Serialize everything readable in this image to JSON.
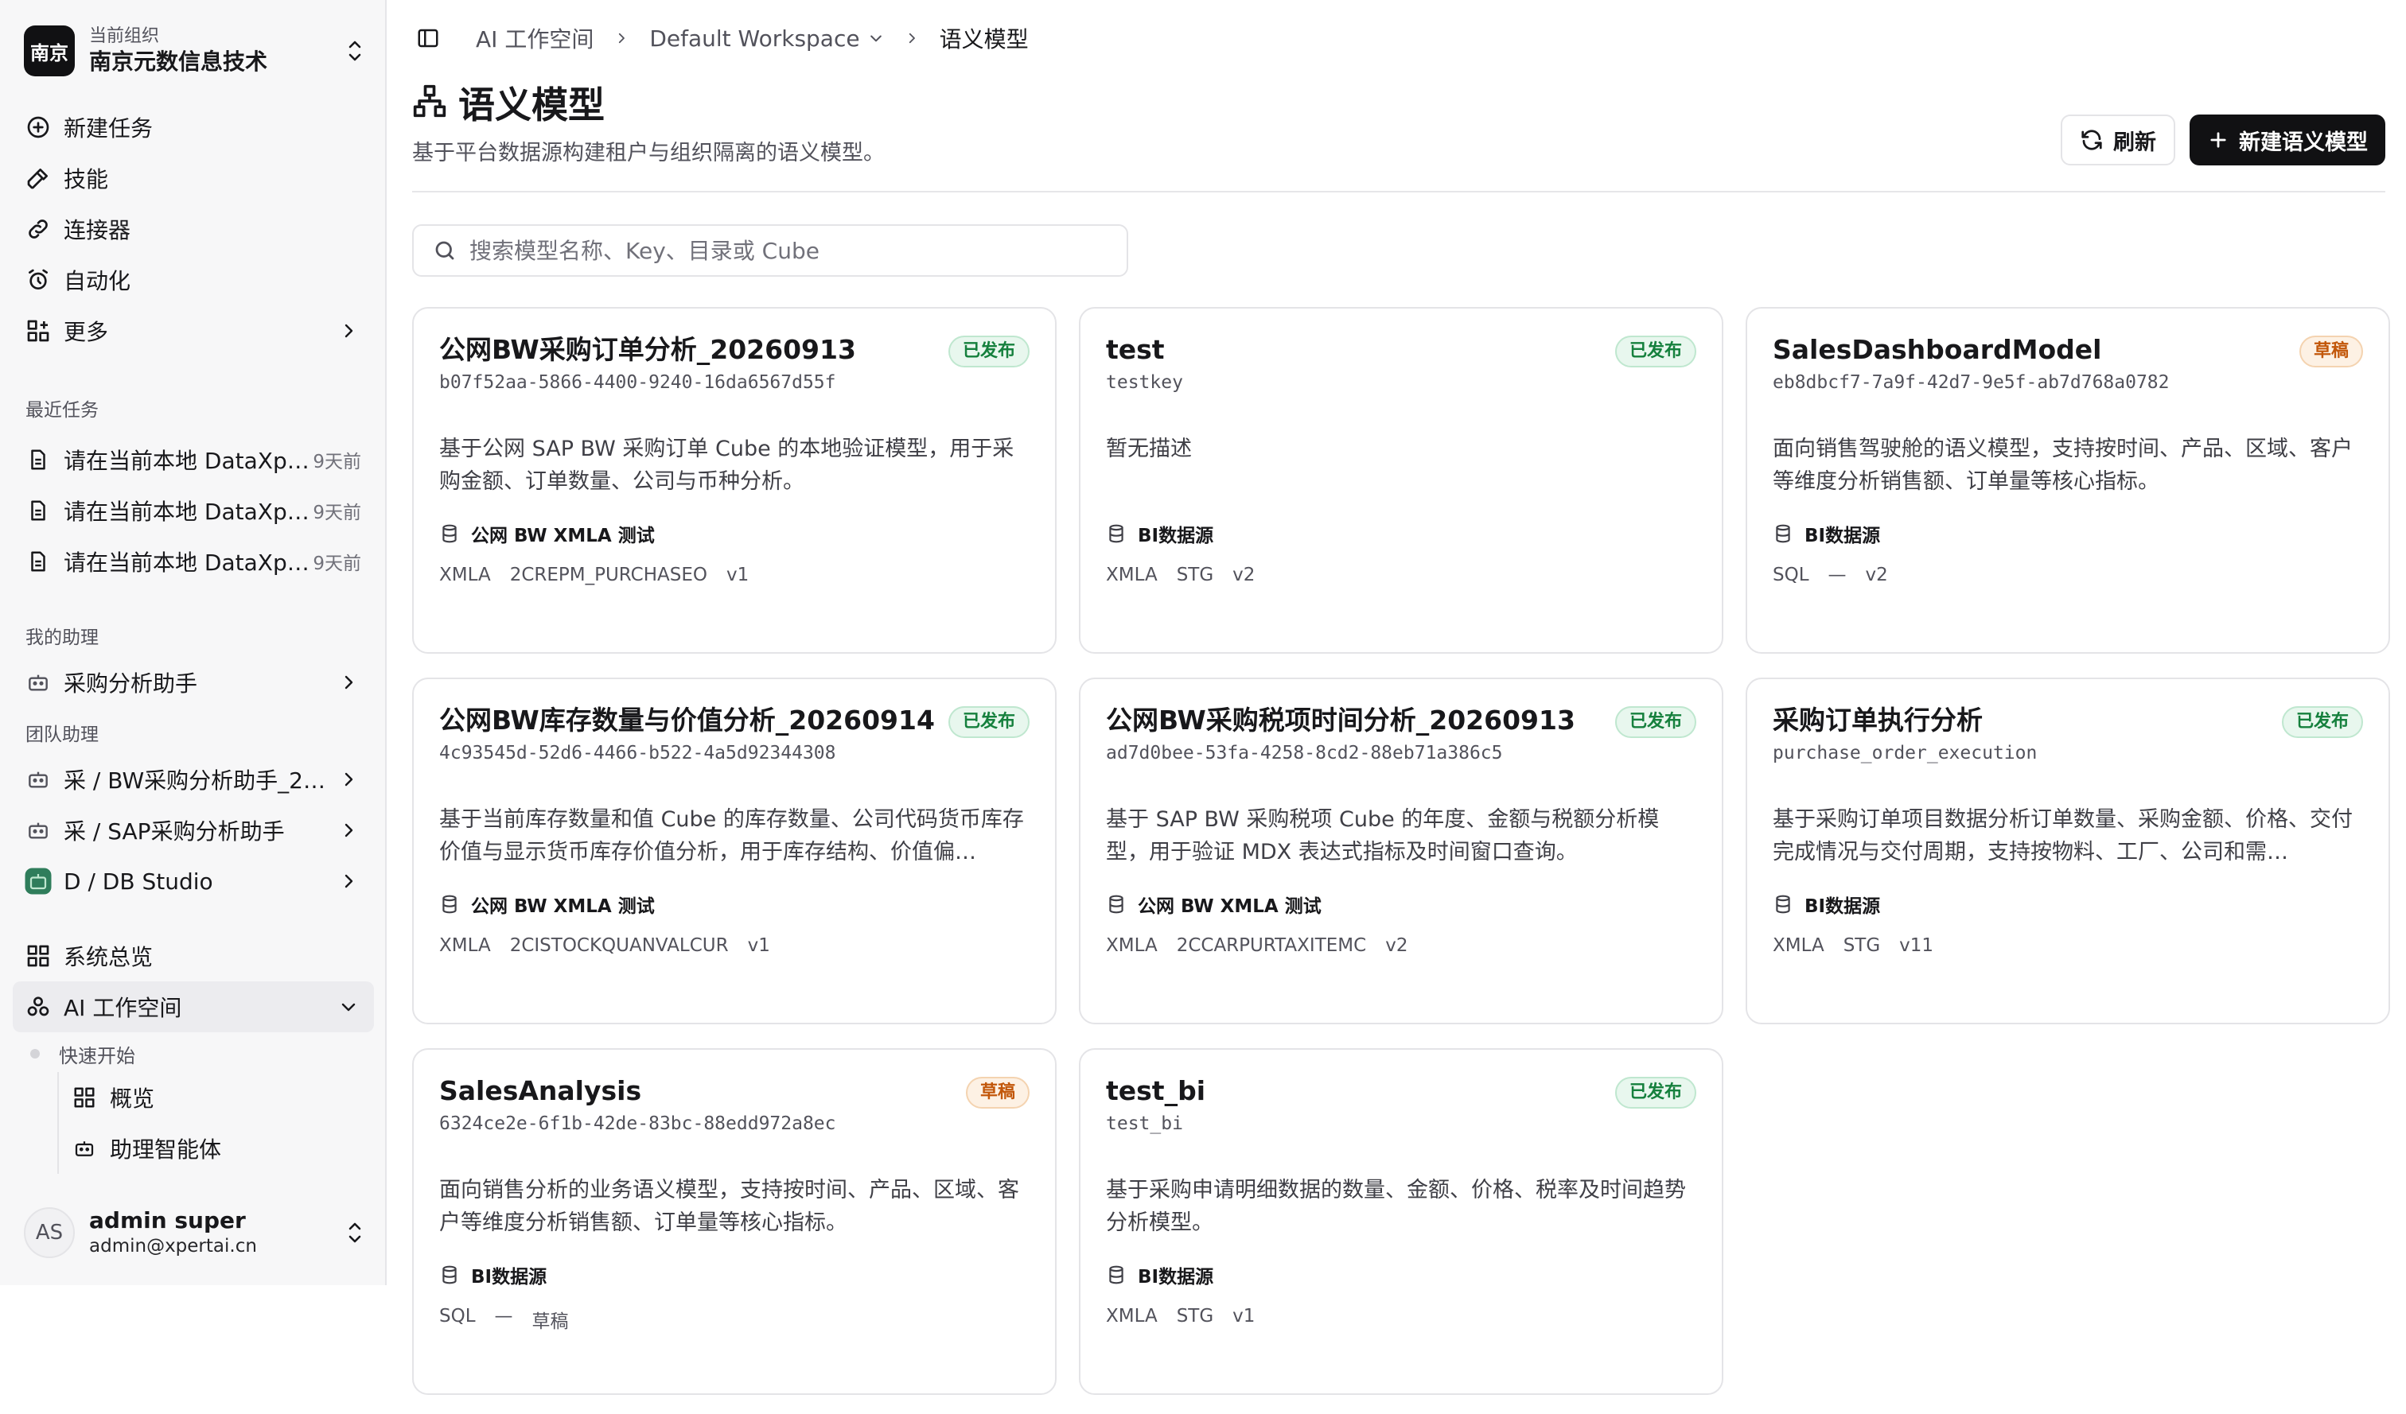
{
  "org": {
    "logo_text": "南京",
    "label": "当前组织",
    "name": "南京元数信息技术"
  },
  "nav": [
    {
      "label": "新建任务",
      "icon": "plus-circle-icon"
    },
    {
      "label": "技能",
      "icon": "hammer-icon"
    },
    {
      "label": "连接器",
      "icon": "link-icon"
    },
    {
      "label": "自动化",
      "icon": "alarm-clock-icon"
    },
    {
      "label": "更多",
      "icon": "grid-plus-icon"
    }
  ],
  "recent": {
    "title": "最近任务",
    "items": [
      {
        "label": "请在当前本地 DataXp…",
        "time": "9天前"
      },
      {
        "label": "请在当前本地 DataXp…",
        "time": "9天前"
      },
      {
        "label": "请在当前本地 DataXp…",
        "time": "9天前"
      }
    ]
  },
  "my_assistants": {
    "title": "我的助理",
    "items": [
      {
        "label": "采购分析助手"
      }
    ]
  },
  "team_assistants": {
    "title": "团队助理",
    "items": [
      {
        "label": "采 / BW采购分析助手_2…"
      },
      {
        "label": "采 / SAP采购分析助手"
      },
      {
        "label": "D / DB Studio"
      }
    ]
  },
  "system": {
    "label": "系统总览"
  },
  "workspace": {
    "label": "AI 工作空间",
    "sub_title": "快速开始",
    "sub_items": [
      {
        "label": "概览"
      },
      {
        "label": "助理智能体"
      }
    ]
  },
  "user": {
    "initials": "AS",
    "name": "admin super",
    "email": "admin@xpertai.cn"
  },
  "breadcrumb": {
    "root": "AI 工作空间",
    "workspace": "Default Workspace",
    "current": "语义模型"
  },
  "page": {
    "title": "语义模型",
    "subtitle": "基于平台数据源构建租户与组织隔离的语义模型。",
    "refresh_label": "刷新",
    "new_label": "新建语义模型",
    "search_placeholder": "搜索模型名称、Key、目录或 Cube"
  },
  "colors": {
    "accent": "#111113",
    "published": "#15803d",
    "draft": "#c2570a"
  },
  "models": [
    {
      "title": "公网BW采购订单分析_20260913",
      "status": "已发布",
      "key": "b07f52aa-5866-4400-9240-16da6567d55f",
      "desc": "基于公网 SAP BW 采购订单 Cube 的本地验证模型，用于采购金额、订单数量、公司与币种分析。",
      "source": "公网 BW XMLA 测试",
      "meta": [
        "XMLA",
        "2CREPM_PURCHASEO",
        "v1"
      ]
    },
    {
      "title": "test",
      "status": "已发布",
      "key": "testkey",
      "desc": "暂无描述",
      "source": "BI数据源",
      "meta": [
        "XMLA",
        "STG",
        "v2"
      ]
    },
    {
      "title": "SalesDashboardModel",
      "status": "草稿",
      "key": "eb8dbcf7-7a9f-42d7-9e5f-ab7d768a0782",
      "desc": "面向销售驾驶舱的语义模型，支持按时间、产品、区域、客户等维度分析销售额、订单量等核心指标。",
      "source": "BI数据源",
      "meta": [
        "SQL",
        "—",
        "v2"
      ]
    },
    {
      "title": "公网BW库存数量与价值分析_20260914",
      "status": "已发布",
      "key": "4c93545d-52d6-4466-b522-4a5d92344308",
      "desc": "基于当前库存数量和值 Cube 的库存数量、公司代码货币库存价值与显示货币库存价值分析，用于库存结构、价值偏…",
      "source": "公网 BW XMLA 测试",
      "meta": [
        "XMLA",
        "2CISTOCKQUANVALCUR",
        "v1"
      ]
    },
    {
      "title": "公网BW采购税项时间分析_20260913",
      "status": "已发布",
      "key": "ad7d0bee-53fa-4258-8cd2-88eb71a386c5",
      "desc": "基于 SAP BW 采购税项 Cube 的年度、金额与税额分析模型，用于验证 MDX 表达式指标及时间窗口查询。",
      "source": "公网 BW XMLA 测试",
      "meta": [
        "XMLA",
        "2CCARPURTAXITEMC",
        "v2"
      ]
    },
    {
      "title": "采购订单执行分析",
      "status": "已发布",
      "key": "purchase_order_execution",
      "desc": "基于采购订单项目数据分析订单数量、采购金额、价格、交付完成情况与交付周期，支持按物料、工厂、公司和需…",
      "source": "BI数据源",
      "meta": [
        "XMLA",
        "STG",
        "v11"
      ]
    },
    {
      "title": "SalesAnalysis",
      "status": "草稿",
      "key": "6324ce2e-6f1b-42de-83bc-88edd972a8ec",
      "desc": "面向销售分析的业务语义模型，支持按时间、产品、区域、客户等维度分析销售额、订单量等核心指标。",
      "source": "BI数据源",
      "meta": [
        "SQL",
        "—",
        "草稿"
      ]
    },
    {
      "title": "test_bi",
      "status": "已发布",
      "key": "test_bi",
      "desc": "基于采购申请明细数据的数量、金额、价格、税率及时间趋势分析模型。",
      "source": "BI数据源",
      "meta": [
        "XMLA",
        "STG",
        "v1"
      ]
    }
  ]
}
